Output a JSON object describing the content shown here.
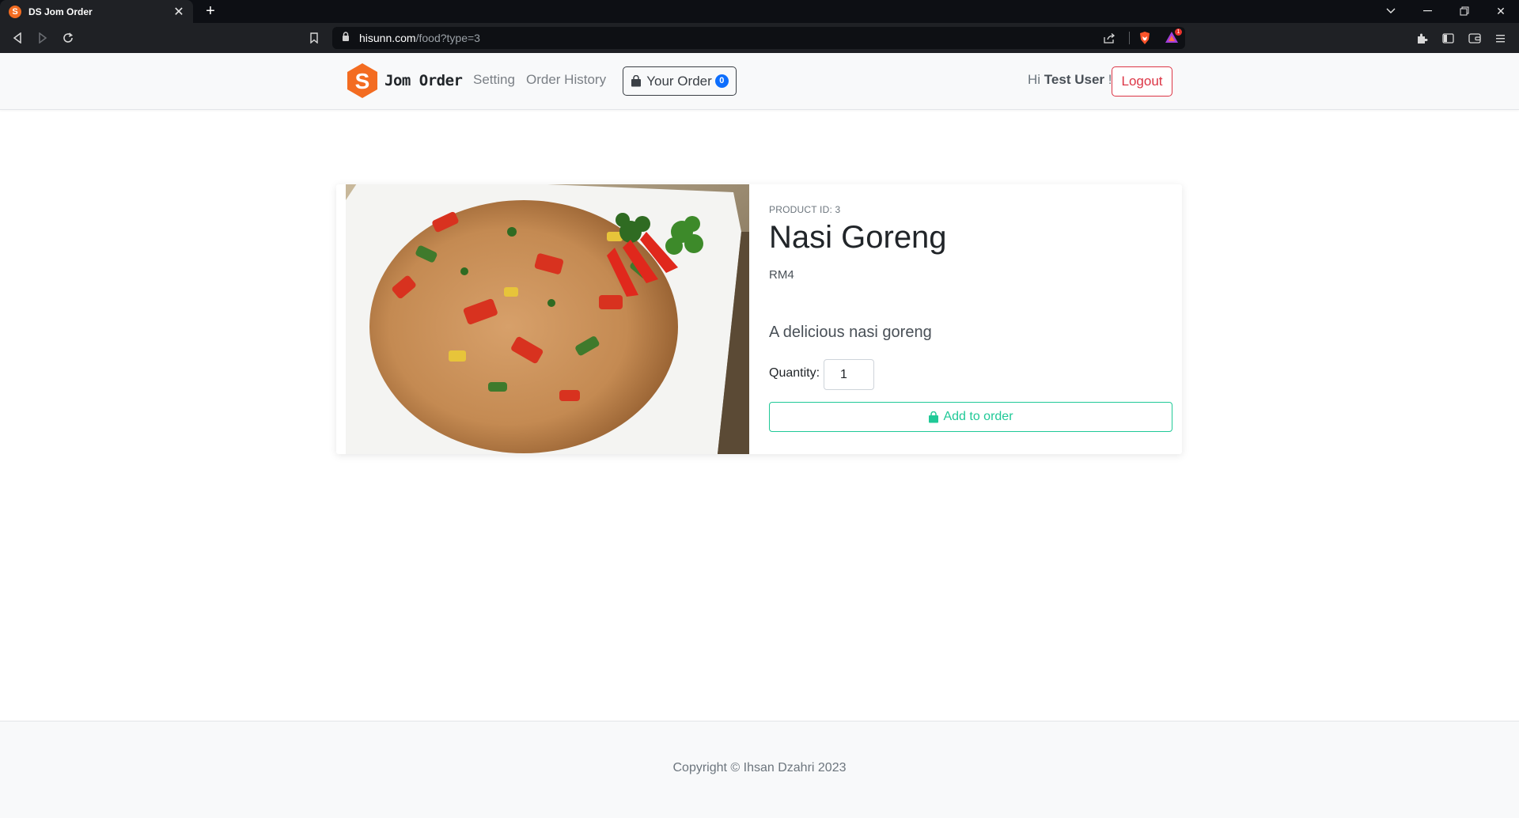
{
  "browser": {
    "tab_title": "DS Jom Order",
    "favicon_letter": "S",
    "url_host": "hisunn.com",
    "url_path": "/food?type=3",
    "rewards_count": "1"
  },
  "navbar": {
    "brand_letter": "S",
    "brand_name": "Jom Order",
    "links": [
      "Setting",
      "Order History"
    ],
    "order_button_label": "Your Order",
    "order_count": "0",
    "greeting_prefix": "Hi",
    "user_name": "Test User",
    "greeting_suffix": "!",
    "logout_label": "Logout"
  },
  "product": {
    "id_label": "PRODUCT ID: 3",
    "name": "Nasi Goreng",
    "price": "RM4",
    "description": "A delicious nasi goreng",
    "quantity_label": "Quantity:",
    "quantity_value": "1",
    "add_button_label": "Add to order"
  },
  "footer": {
    "copyright": "Copyright © Ihsan Dzahri 2023"
  },
  "colors": {
    "brand_orange": "#f36c21",
    "success": "#20c997",
    "danger": "#dc3545",
    "primary": "#0d6efd"
  }
}
